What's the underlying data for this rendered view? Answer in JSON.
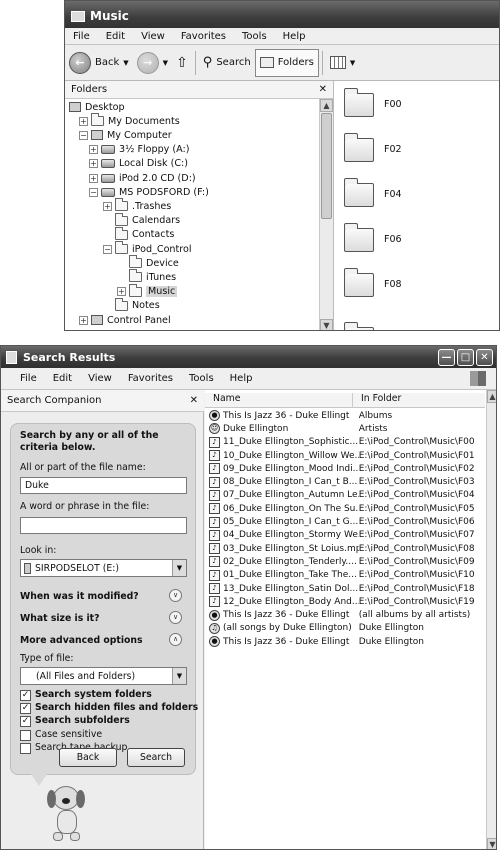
{
  "explorer": {
    "title": "Music",
    "menu": [
      "File",
      "Edit",
      "View",
      "Favorites",
      "Tools",
      "Help"
    ],
    "toolbar": {
      "back": "Back",
      "search": "Search",
      "folders": "Folders"
    },
    "folders_pane": {
      "title": "Folders",
      "tree": [
        {
          "label": "Desktop",
          "icon": "desktop-icon",
          "expander": ""
        },
        {
          "label": "My Documents",
          "icon": "folder-icon",
          "expander": "+"
        },
        {
          "label": "My Computer",
          "icon": "computer-icon",
          "expander": "−"
        },
        {
          "label": "3½ Floppy (A:)",
          "icon": "floppy-icon",
          "expander": "+"
        },
        {
          "label": "Local Disk (C:)",
          "icon": "disk-icon",
          "expander": "+"
        },
        {
          "label": "iPod 2.0 CD (D:)",
          "icon": "cd-icon",
          "expander": "+"
        },
        {
          "label": "MS PODSFORD (F:)",
          "icon": "drive-icon",
          "expander": "−"
        },
        {
          "label": ".Trashes",
          "icon": "folder-icon",
          "expander": "+"
        },
        {
          "label": "Calendars",
          "icon": "folder-icon",
          "expander": ""
        },
        {
          "label": "Contacts",
          "icon": "folder-icon",
          "expander": ""
        },
        {
          "label": "iPod_Control",
          "icon": "folder-icon",
          "expander": "−"
        },
        {
          "label": "Device",
          "icon": "folder-icon",
          "expander": ""
        },
        {
          "label": "iTunes",
          "icon": "folder-icon",
          "expander": ""
        },
        {
          "label": "Music",
          "icon": "folder-icon",
          "expander": "+"
        },
        {
          "label": "Notes",
          "icon": "folder-icon",
          "expander": ""
        },
        {
          "label": "Control Panel",
          "icon": "control-panel-icon",
          "expander": "+"
        }
      ]
    },
    "content_folders": [
      "F00",
      "F02",
      "F04",
      "F06",
      "F08"
    ]
  },
  "search": {
    "title": "Search Results",
    "menu": [
      "File",
      "Edit",
      "View",
      "Favorites",
      "Tools",
      "Help"
    ],
    "companion": {
      "title": "Search Companion",
      "heading": "Search by any or all of the criteria below.",
      "name_label": "All or part of the file name:",
      "name_value": "Duke",
      "phrase_label": "A word or phrase in the file:",
      "phrase_value": "",
      "lookin_label": "Look in:",
      "lookin_value": "SIRPODSELOT (E:)",
      "when_modified": "When was it modified?",
      "what_size": "What size is it?",
      "advanced": "More advanced options",
      "type_label": "Type of file:",
      "type_value": "(All Files and Folders)",
      "options": [
        {
          "label": "Search system folders",
          "checked": true
        },
        {
          "label": "Search hidden files and folders",
          "checked": true
        },
        {
          "label": "Search subfolders",
          "checked": true
        },
        {
          "label": "Case sensitive",
          "checked": false
        },
        {
          "label": "Search tape backup",
          "checked": false
        }
      ],
      "back_button": "Back",
      "search_button": "Search"
    },
    "results": {
      "columns": [
        "Name",
        "In Folder"
      ],
      "rows": [
        {
          "name": "This Is Jazz 36 - Duke Ellingt",
          "folder": "Albums",
          "icon": "cd-icon"
        },
        {
          "name": "Duke Ellington",
          "folder": "Artists",
          "icon": "artist-icon"
        },
        {
          "name": "11_Duke Ellington_Sophistic...",
          "folder": "E:\\iPod_Control\\Music\\F00",
          "icon": "music-file-icon"
        },
        {
          "name": "10_Duke Ellington_Willow We...",
          "folder": "E:\\iPod_Control\\Music\\F01",
          "icon": "music-file-icon"
        },
        {
          "name": "09_Duke Ellington_Mood Indi...",
          "folder": "E:\\iPod_Control\\Music\\F02",
          "icon": "music-file-icon"
        },
        {
          "name": "08_Duke Ellington_I Can_t B...",
          "folder": "E:\\iPod_Control\\Music\\F03",
          "icon": "music-file-icon"
        },
        {
          "name": "07_Duke Ellington_Autumn Le...",
          "folder": "E:\\iPod_Control\\Music\\F04",
          "icon": "music-file-icon"
        },
        {
          "name": "06_Duke Ellington_On The Su...",
          "folder": "E:\\iPod_Control\\Music\\F05",
          "icon": "music-file-icon"
        },
        {
          "name": "05_Duke Ellington_I Can_t G...",
          "folder": "E:\\iPod_Control\\Music\\F06",
          "icon": "music-file-icon"
        },
        {
          "name": "04_Duke Ellington_Stormy We...",
          "folder": "E:\\iPod_Control\\Music\\F07",
          "icon": "music-file-icon"
        },
        {
          "name": "03_Duke Ellington_St Loius.mp3",
          "folder": "E:\\iPod_Control\\Music\\F08",
          "icon": "music-file-icon"
        },
        {
          "name": "02_Duke Ellington_Tenderly....",
          "folder": "E:\\iPod_Control\\Music\\F09",
          "icon": "music-file-icon"
        },
        {
          "name": "01_Duke Ellington_Take The...",
          "folder": "E:\\iPod_Control\\Music\\F10",
          "icon": "music-file-icon"
        },
        {
          "name": "13_Duke Ellington_Satin Dol...",
          "folder": "E:\\iPod_Control\\Music\\F18",
          "icon": "music-file-icon"
        },
        {
          "name": "12_Duke Ellington_Body And....",
          "folder": "E:\\iPod_Control\\Music\\F19",
          "icon": "music-file-icon"
        },
        {
          "name": "This Is Jazz 36 - Duke Ellingt",
          "folder": "(all albums by all artists)",
          "icon": "cd-icon"
        },
        {
          "name": "(all songs by Duke Ellington)",
          "folder": "Duke Ellington",
          "icon": "music-note-icon"
        },
        {
          "name": "This Is Jazz 36 - Duke Ellingt",
          "folder": "Duke Ellington",
          "icon": "cd-icon"
        }
      ]
    }
  }
}
